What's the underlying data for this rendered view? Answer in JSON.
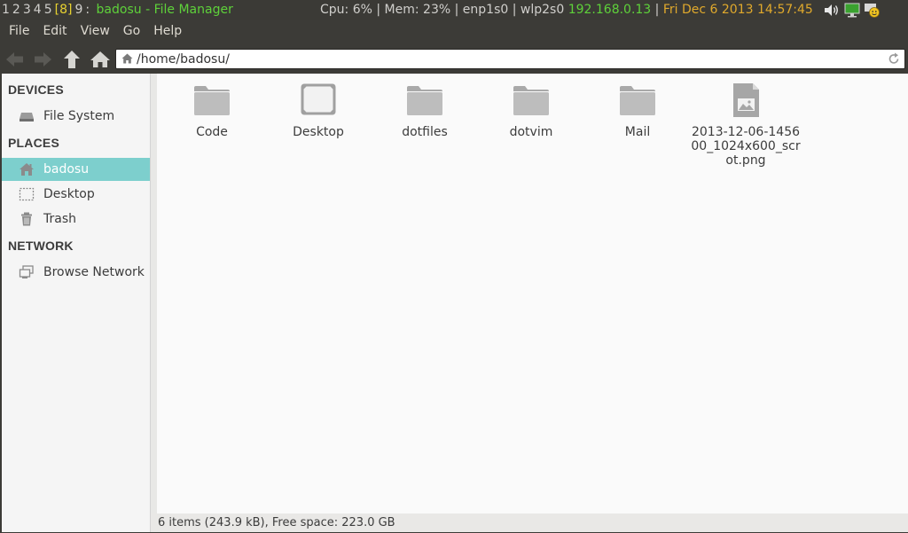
{
  "status_bar": {
    "workspaces": [
      "1",
      "2",
      "3",
      "4",
      "5",
      "[8]",
      "9"
    ],
    "separator": ":",
    "window_title": "badosu - File Manager",
    "cpu": "Cpu: 6%",
    "mem": "Mem: 23%",
    "net1": "enp1s0",
    "net2": "wlp2s0",
    "ip": "192.168.0.13",
    "datetime": "Fri Dec  6 2013 14:57:45",
    "sep": "|",
    "colors": {
      "active_ws": "#e8d230",
      "title": "#5ed13a",
      "ip": "#5ed13a",
      "clock": "#e0a92c"
    }
  },
  "menubar": {
    "items": [
      "File",
      "Edit",
      "View",
      "Go",
      "Help"
    ]
  },
  "toolbar": {
    "back_icon": "arrow-left-icon",
    "forward_icon": "arrow-right-icon",
    "up_icon": "arrow-up-icon",
    "home_icon": "home-icon",
    "path": "/home/badosu/",
    "reload_icon": "reload-icon"
  },
  "sidebar": {
    "sections": [
      {
        "title": "DEVICES",
        "items": [
          {
            "label": "File System",
            "icon": "harddisk-icon"
          }
        ]
      },
      {
        "title": "PLACES",
        "items": [
          {
            "label": "badosu",
            "icon": "home-icon",
            "selected": true
          },
          {
            "label": "Desktop",
            "icon": "desktop-icon"
          },
          {
            "label": "Trash",
            "icon": "trash-icon"
          }
        ]
      },
      {
        "title": "NETWORK",
        "items": [
          {
            "label": "Browse Network",
            "icon": "network-icon"
          }
        ]
      }
    ],
    "selected_color": "#7dcfcd"
  },
  "files": [
    {
      "name": "Code",
      "icon": "folder-icon"
    },
    {
      "name": "Desktop",
      "icon": "desktop-folder-icon"
    },
    {
      "name": "dotfiles",
      "icon": "folder-icon"
    },
    {
      "name": "dotvim",
      "icon": "folder-icon"
    },
    {
      "name": "Mail",
      "icon": "folder-icon"
    },
    {
      "name": "2013-12-06-145600_1024x600_scrot.png",
      "icon": "image-file-icon"
    }
  ],
  "statusbar_footer": "6 items (243.9 kB), Free space: 223.0 GB"
}
